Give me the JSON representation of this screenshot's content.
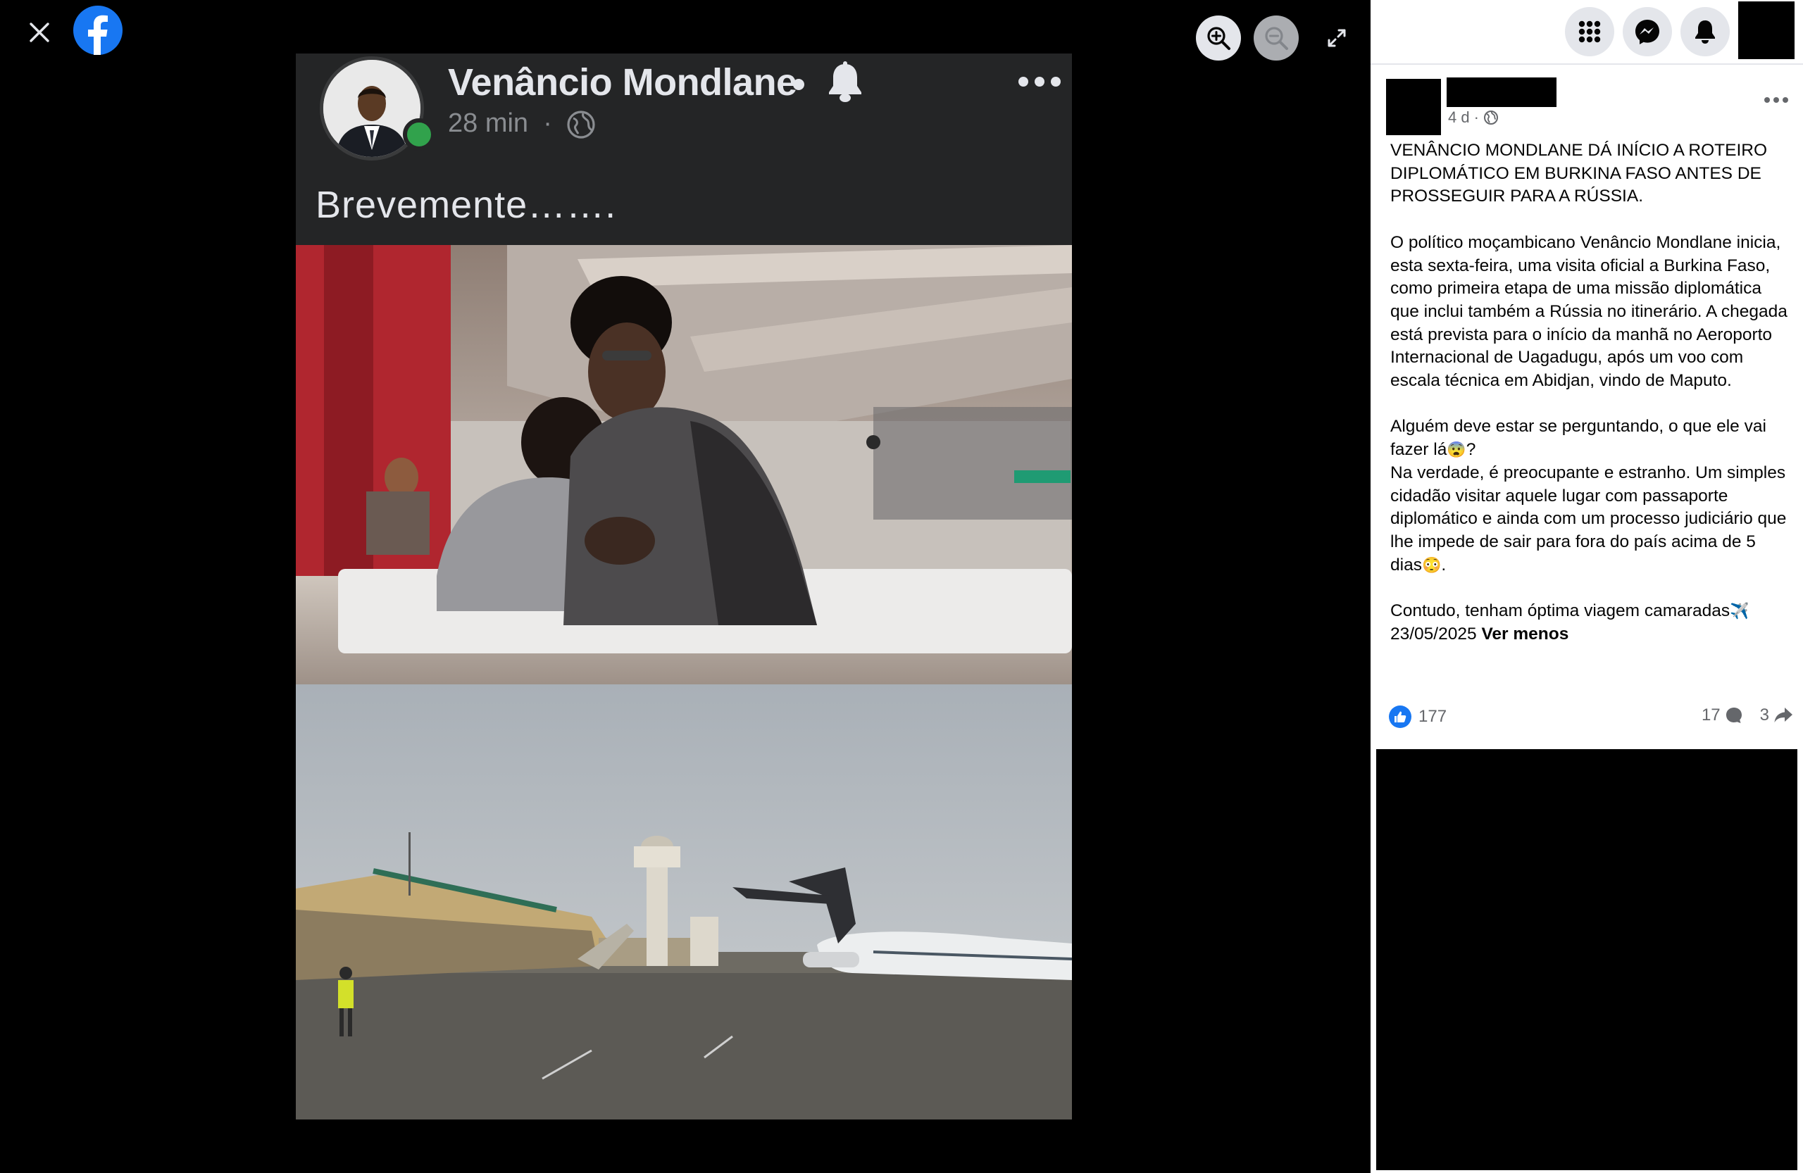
{
  "viewer": {
    "icons": {
      "close": "close-icon",
      "logo": "facebook-logo-icon",
      "zoom_in": "zoom-in-icon",
      "zoom_out": "zoom-out-icon",
      "fullscreen": "fullscreen-icon"
    },
    "photo": {
      "author_name": "Venâncio Mondlane",
      "time": "28 min",
      "separator": "·",
      "caption": "Brevemente……."
    }
  },
  "topbar": {
    "icons": [
      "menu-grid-icon",
      "messenger-icon",
      "notifications-bell-icon"
    ]
  },
  "post": {
    "meta_time": "4 d",
    "meta_separator": "·",
    "paragraph1": "VENÂNCIO MONDLANE DÁ INÍCIO A ROTEIRO DIPLOMÁTICO EM BURKINA FASO ANTES DE PROSSEGUIR PARA A RÚSSIA.",
    "paragraph2": "O político moçambicano Venâncio Mondlane inicia, esta sexta-feira, uma visita oficial a Burkina Faso, como primeira etapa de uma missão diplomática que inclui também a Rússia no itinerário. A chegada está prevista para o início da manhã no Aeroporto Internacional de Uagadugu, após um voo com escala técnica em Abidjan, vindo de Maputo.",
    "paragraph3_a": "Alguém deve estar se perguntando, o que ele vai fazer lá",
    "paragraph3_emoji": "😨",
    "paragraph3_b": "?",
    "paragraph4_a": "Na verdade, é preocupante e estranho. Um simples cidadão visitar aquele lugar com passaporte diplomático e ainda com um processo judiciário que lhe impede de sair para fora do país acima de 5 dias",
    "paragraph4_emoji": "😳",
    "paragraph4_b": ".",
    "paragraph5_a": "Contudo, tenham óptima viagem camaradas",
    "paragraph5_emoji": "✈️",
    "date_line": "23/05/2025",
    "see_less": "Ver menos",
    "likes": "177",
    "comments": "17",
    "shares": "3"
  },
  "colors": {
    "facebook_blue": "#1877f2",
    "online_green": "#31a24c",
    "dark_card": "#242526",
    "panel_bg": "#ffffff",
    "secondary_text": "#65676b"
  }
}
